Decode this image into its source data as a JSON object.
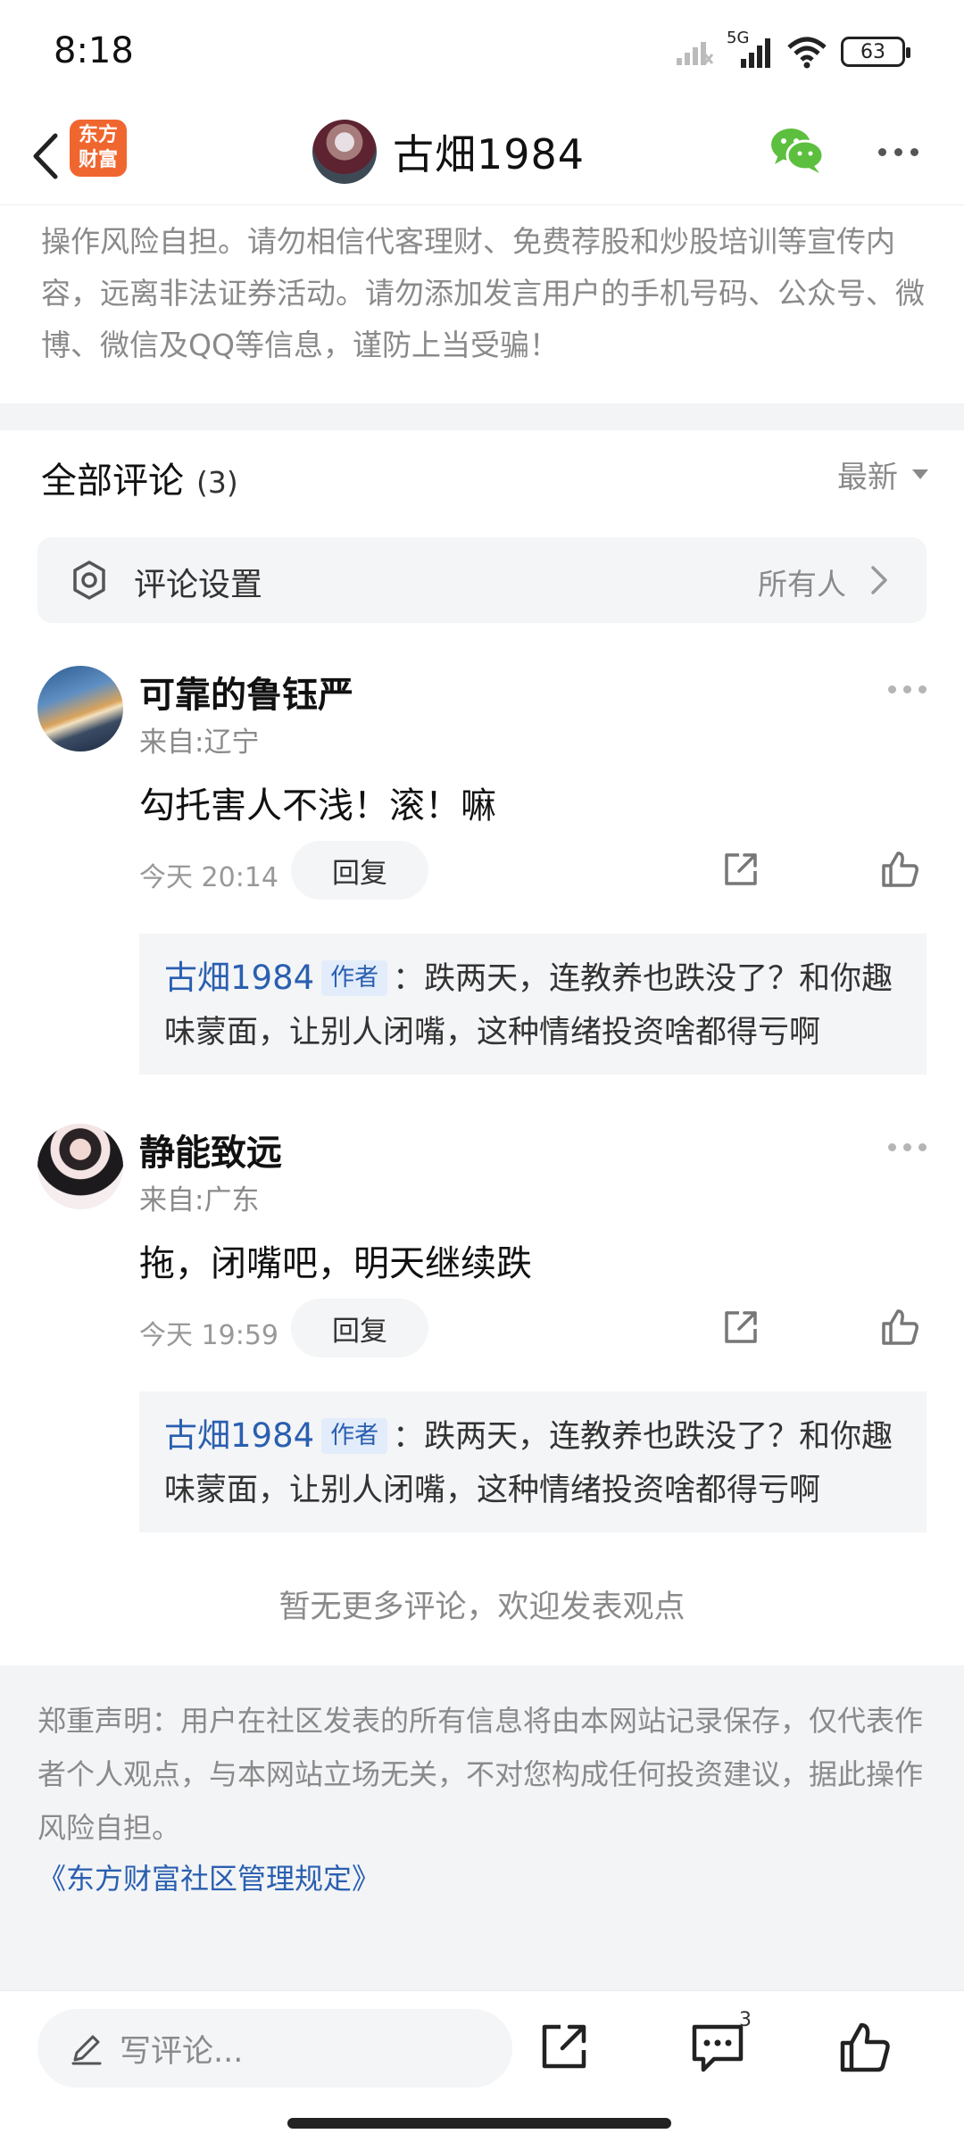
{
  "status_bar": {
    "time": "8:18",
    "network": "5G",
    "battery": "63"
  },
  "nav": {
    "brand_line1": "东方",
    "brand_line2": "财富",
    "title": "古畑1984"
  },
  "risk_notice": "操作风险自担。请勿相信代客理财、免费荐股和炒股培训等宣传内容，远离非法证券活动。请勿添加发言用户的手机号码、公众号、微博、微信及QQ等信息，谨防上当受骗！",
  "comments_header": {
    "title": "全部评论",
    "count": "(3)",
    "sort": "最新"
  },
  "settings": {
    "label": "评论设置",
    "value": "所有人"
  },
  "comments": [
    {
      "name": "可靠的鲁钰严",
      "location": "来自:辽宁",
      "text": "勾托害人不浅！滚！嘛",
      "time": "今天 20:14",
      "reply_label": "回复",
      "reply": {
        "author": "古畑1984",
        "tag": "作者",
        "text": "：跌两天，连教养也跌没了？和你趣味蒙面，让别人闭嘴，这种情绪投资啥都得亏啊"
      }
    },
    {
      "name": "静能致远",
      "location": "来自:广东",
      "text": "拖，闭嘴吧，明天继续跌",
      "time": "今天 19:59",
      "reply_label": "回复",
      "reply": {
        "author": "古畑1984",
        "tag": "作者",
        "text": "：跌两天，连教养也跌没了？和你趣味蒙面，让别人闭嘴，这种情绪投资啥都得亏啊"
      }
    }
  ],
  "no_more": "暂无更多评论，欢迎发表观点",
  "disclaimer": {
    "text": "郑重声明：用户在社区发表的所有信息将由本网站记录保存，仅代表作者个人观点，与本网站立场无关，不对您构成任何投资建议，据此操作风险自担。",
    "link": "《东方财富社区管理规定》"
  },
  "bottom_bar": {
    "placeholder": "写评论...",
    "comment_count": "3"
  },
  "colors": {
    "brand": "#f0662f",
    "link": "#2a5fb0",
    "wechat": "#5cbf3e"
  }
}
